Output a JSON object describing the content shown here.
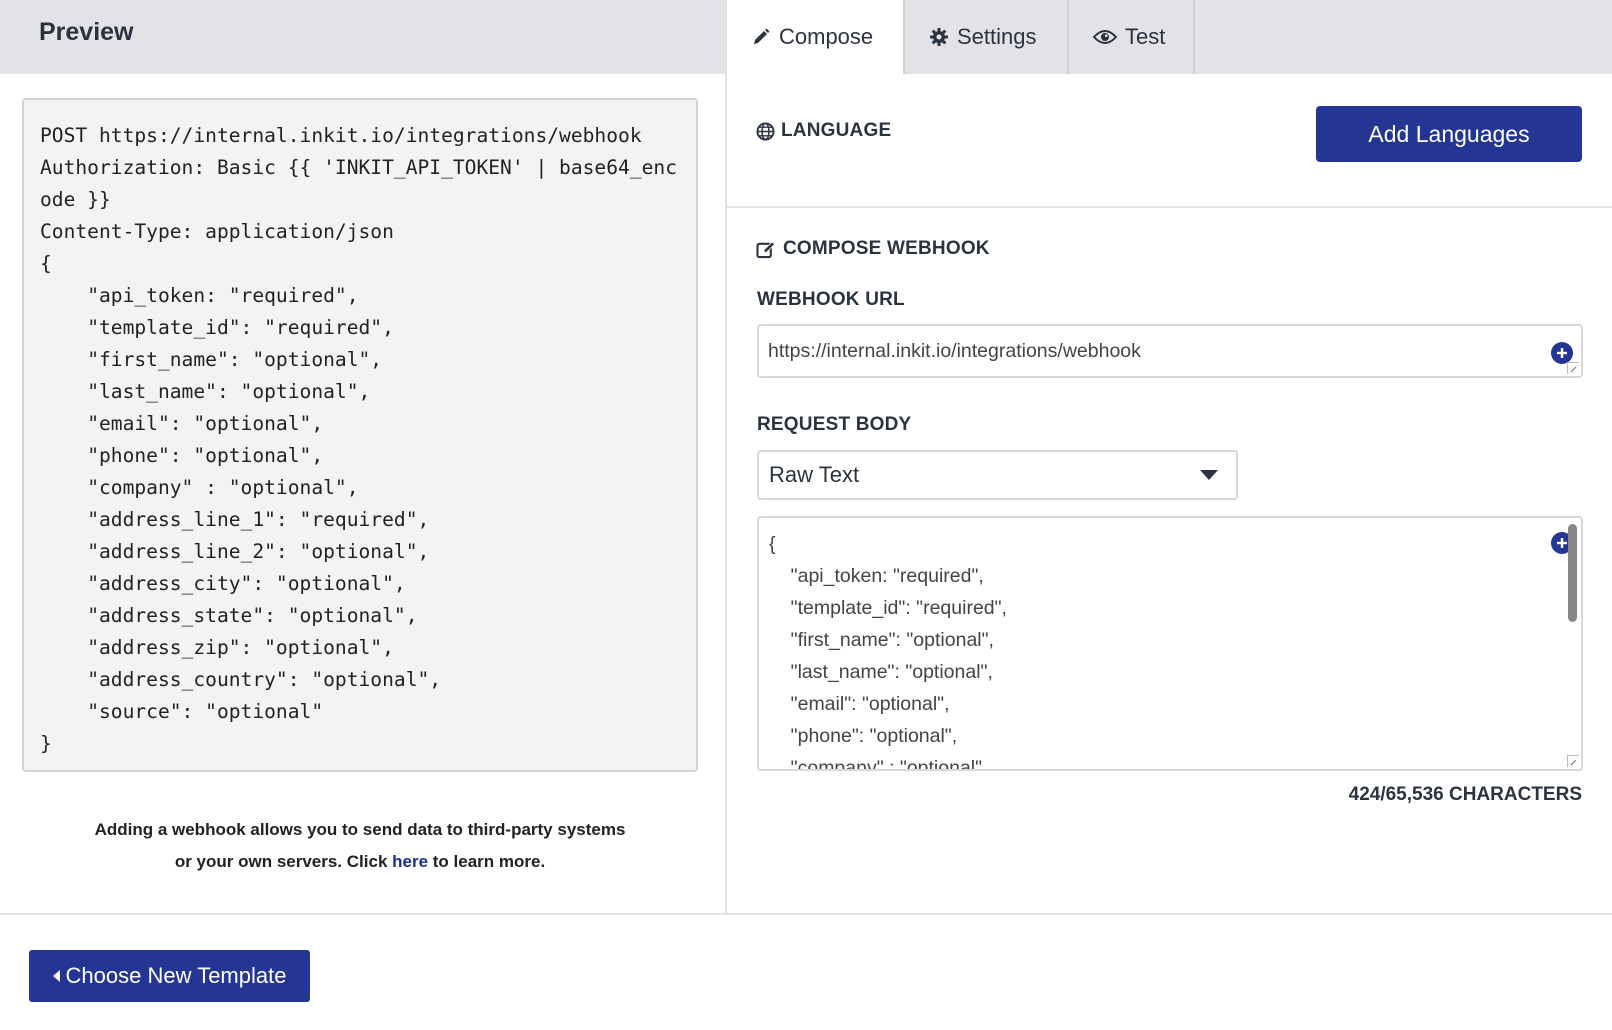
{
  "preview": {
    "title": "Preview",
    "code": "POST https://internal.inkit.io/integrations/webhook\nAuthorization: Basic {{ 'INKIT_API_TOKEN' | base64_encode }}\nContent-Type: application/json\n{\n    \"api_token: \"required\",\n    \"template_id\": \"required\",\n    \"first_name\": \"optional\",\n    \"last_name\": \"optional\",\n    \"email\": \"optional\",\n    \"phone\": \"optional\",\n    \"company\" : \"optional\",\n    \"address_line_1\": \"required\",\n    \"address_line_2\": \"optional\",\n    \"address_city\": \"optional\",\n    \"address_state\": \"optional\",\n    \"address_zip\": \"optional\",\n    \"address_country\": \"optional\",\n    \"source\": \"optional\"\n}",
    "help_line1": "Adding a webhook allows you to send data to third-party systems",
    "help_line2_before": "or your own servers. Click ",
    "help_link": "here",
    "help_line2_after": " to learn more."
  },
  "tabs": {
    "compose": "Compose",
    "settings": "Settings",
    "test": "Test"
  },
  "icons": {
    "compose": "pencil-icon",
    "settings": "gear-icon",
    "test": "eye-icon",
    "language": "globe-icon",
    "compose_webhook": "edit-square-icon",
    "add_variable": "plus-circle-icon"
  },
  "language": {
    "label": "LANGUAGE",
    "add_button": "Add Languages"
  },
  "compose_webhook": {
    "label": "COMPOSE WEBHOOK",
    "url_label": "WEBHOOK URL",
    "url_value": "https://internal.inkit.io/integrations/webhook",
    "request_body_label": "REQUEST BODY",
    "body_type": "Raw Text",
    "body_value": "{\n    \"api_token: \"required\",\n    \"template_id\": \"required\",\n    \"first_name\": \"optional\",\n    \"last_name\": \"optional\",\n    \"email\": \"optional\",\n    \"phone\": \"optional\",\n    \"company\" : \"optional\",",
    "char_count": "424/65,536 CHARACTERS"
  },
  "footer": {
    "choose_template": "Choose New Template"
  },
  "colors": {
    "primary": "#253593",
    "header_bg": "#e3e3e7",
    "link": "#1e2e8f"
  }
}
